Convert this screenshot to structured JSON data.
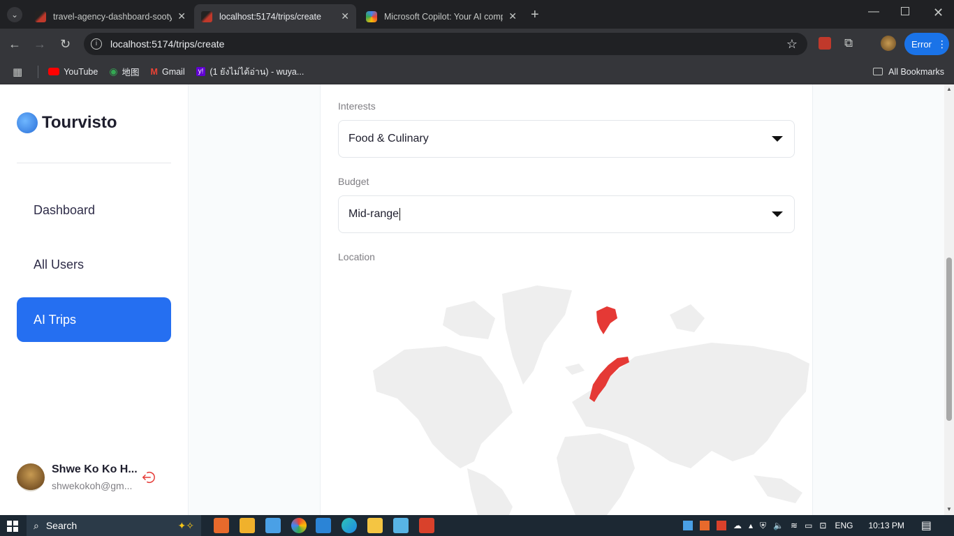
{
  "browser": {
    "tabs": [
      {
        "title": "travel-agency-dashboard-sooty",
        "active": false
      },
      {
        "title": "localhost:5174/trips/create",
        "active": true
      },
      {
        "title": "Microsoft Copilot: Your AI comp",
        "active": false
      }
    ],
    "url": "localhost:5174/trips/create",
    "profile_status": "Error",
    "bookmarks": [
      {
        "label": "YouTube",
        "icon": "youtube-icon"
      },
      {
        "label": "地图",
        "icon": "maps-icon"
      },
      {
        "label": "Gmail",
        "icon": "gmail-icon"
      },
      {
        "label": "(1 ยังไม่ได้อ่าน) - wuya...",
        "icon": "yahoo-icon"
      }
    ],
    "all_bookmarks": "All Bookmarks"
  },
  "sidebar": {
    "brand": "Tourvisto",
    "items": [
      {
        "label": "Dashboard",
        "active": false
      },
      {
        "label": "All Users",
        "active": false
      },
      {
        "label": "AI Trips",
        "active": true
      }
    ],
    "user": {
      "name": "Shwe Ko Ko H...",
      "email": "shwekokoh@gm..."
    }
  },
  "form": {
    "interests_label": "Interests",
    "interests_value": "Food & Culinary",
    "budget_label": "Budget",
    "budget_value": "Mid-range",
    "location_label": "Location",
    "highlighted_region_color": "#e53935",
    "map_color": "#eeeeee"
  },
  "taskbar": {
    "search": "Search",
    "language": "ENG",
    "time": "10:13 PM"
  },
  "colors": {
    "accent": "#256ff1",
    "chrome_dark": "#202124",
    "chrome_toolbar": "#35363a"
  }
}
